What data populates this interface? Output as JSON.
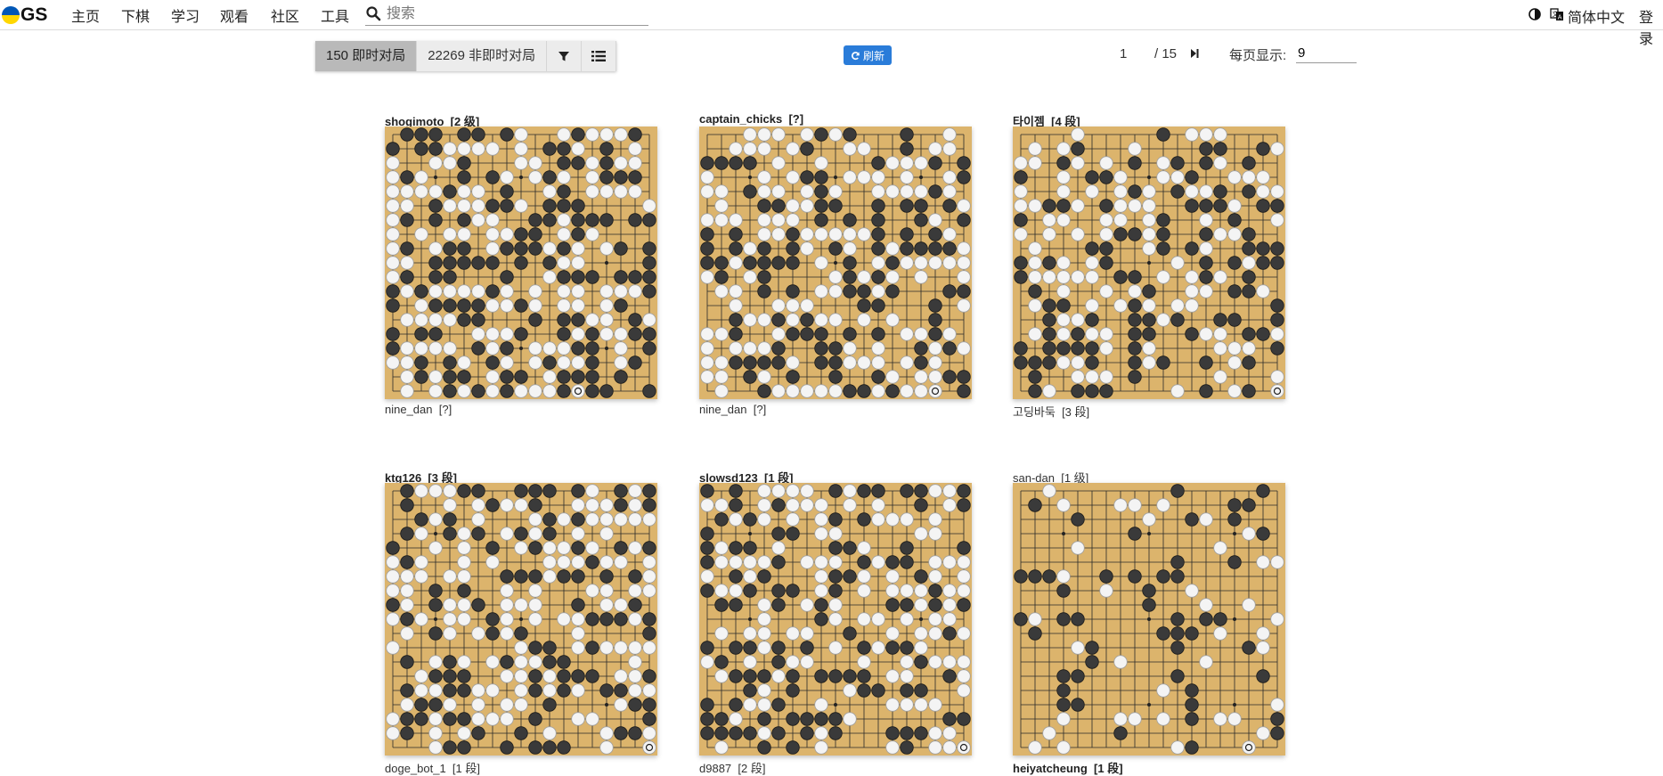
{
  "nav": {
    "logo_text": "GS",
    "items": [
      "主页",
      "下棋",
      "学习",
      "观看",
      "社区",
      "工具"
    ],
    "search_placeholder": "搜索",
    "language": "简体中文",
    "login": "登录"
  },
  "toolbar": {
    "live_tab": "150 即时对局",
    "corr_tab": "22269 非即时对局",
    "refresh_label": "刷新",
    "page_current": "1",
    "page_total": "/ 15",
    "per_page_label": "每页显示:",
    "per_page_value": "9"
  },
  "games": [
    {
      "top_player": "shogimoto",
      "top_rank": "[2 级]",
      "top_bold": true,
      "bottom_player": "nine_dan",
      "bottom_rank": "[?]",
      "bottom_bold": false,
      "seed": 11,
      "black": 0.34,
      "white": 0.36
    },
    {
      "top_player": "captain_chicks",
      "top_rank": "[?]",
      "top_bold": true,
      "bottom_player": "nine_dan",
      "bottom_rank": "[?]",
      "bottom_bold": false,
      "seed": 23,
      "black": 0.3,
      "white": 0.34
    },
    {
      "top_player": "타이젬",
      "top_rank": "[4 段]",
      "top_bold": true,
      "bottom_player": "고딩바둑",
      "bottom_rank": "[3 段]",
      "bottom_bold": false,
      "seed": 37,
      "black": 0.27,
      "white": 0.3
    },
    {
      "top_player": "ktg126",
      "top_rank": "[3 段]",
      "top_bold": true,
      "bottom_player": "doge_bot_1",
      "bottom_rank": "[1 段]",
      "bottom_bold": false,
      "seed": 41,
      "black": 0.32,
      "white": 0.34
    },
    {
      "top_player": "slowsd123",
      "top_rank": "[1 段]",
      "top_bold": true,
      "bottom_player": "d9887",
      "bottom_rank": "[2 段]",
      "bottom_bold": false,
      "seed": 53,
      "black": 0.28,
      "white": 0.3
    },
    {
      "top_player": "san-dan",
      "top_rank": "[1 级]",
      "top_bold": false,
      "bottom_player": "heiyatcheung",
      "bottom_rank": "[1 段]",
      "bottom_bold": true,
      "seed": 67,
      "black": 0.1,
      "white": 0.1
    }
  ],
  "colors": {
    "board": "#dcb46c",
    "board_line": "#2a2a2a",
    "accent": "#2a7cd9"
  }
}
